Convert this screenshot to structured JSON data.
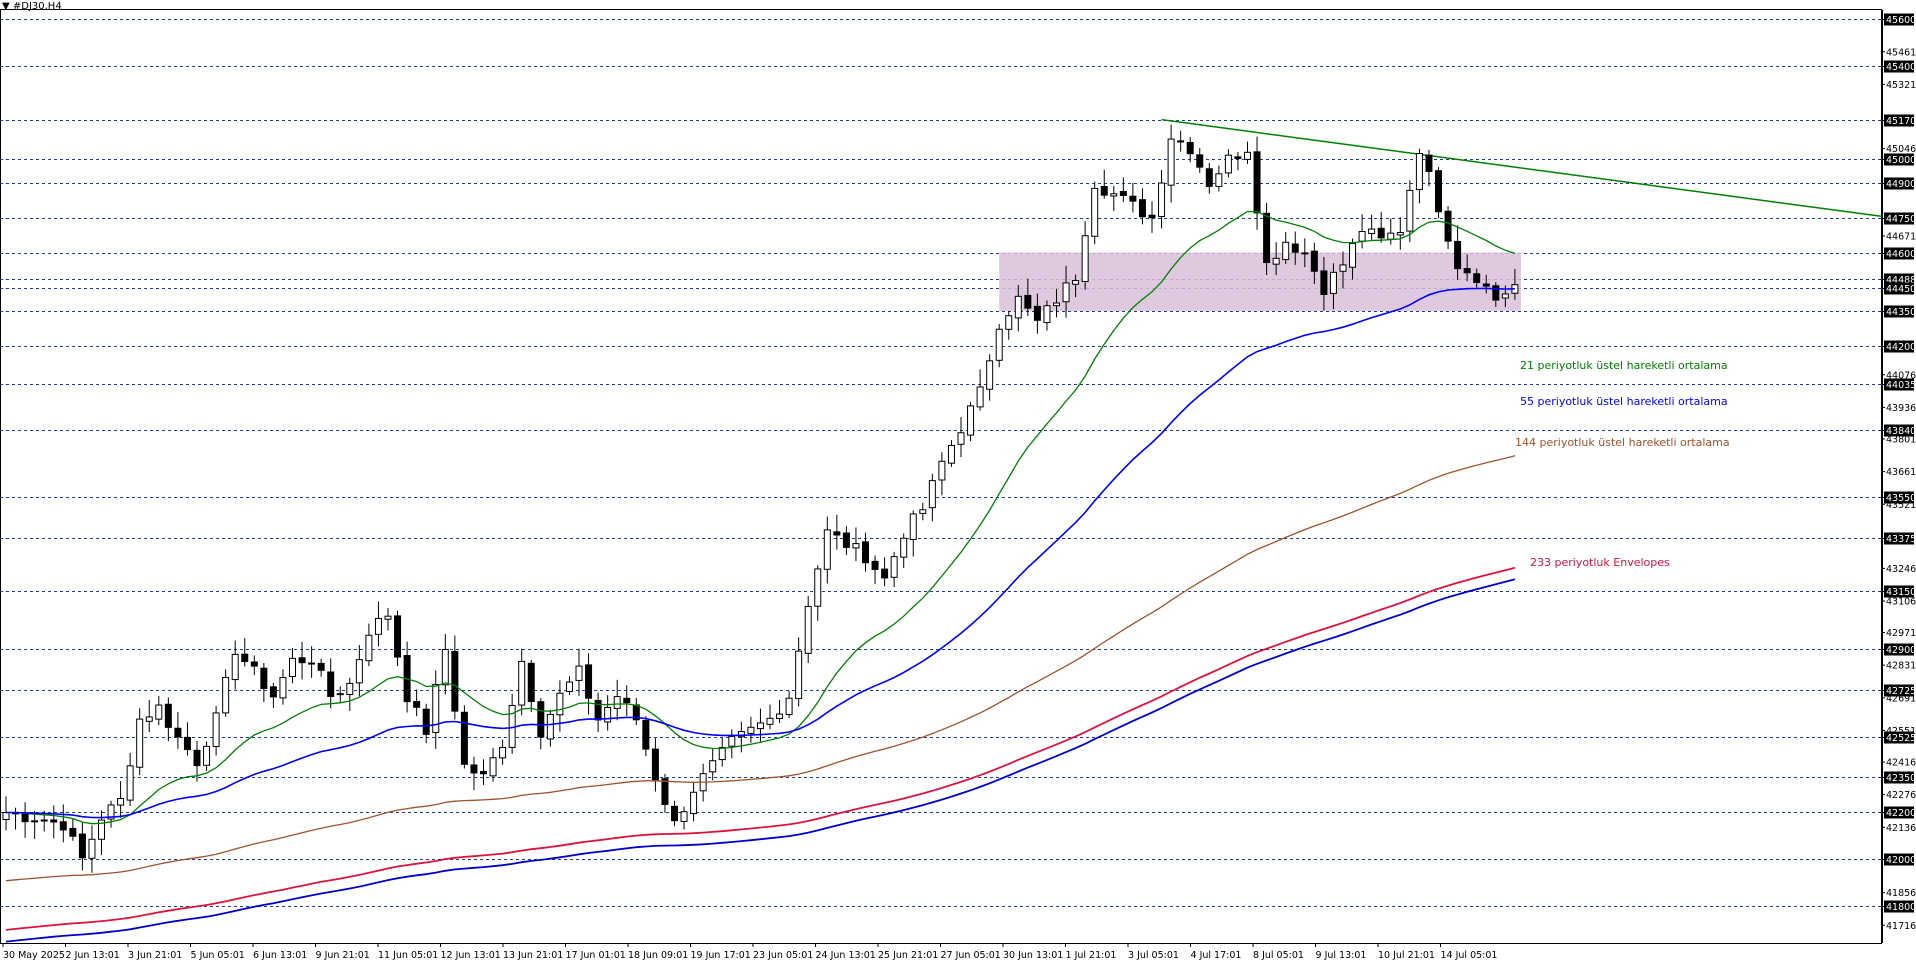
{
  "chart_title": "▼ #DJ30,H4",
  "chart_data": {
    "type": "candlestick",
    "symbol": "#DJ30",
    "timeframe": "H4",
    "ylim": [
      41640,
      45640
    ],
    "grid": "dashed horizontal lines at key levels",
    "key_levels": [
      45600,
      45400,
      45170,
      45000,
      44900,
      44750,
      44600,
      44488,
      44450,
      44350,
      44200,
      44035,
      43840,
      43550,
      43375,
      43150,
      42900,
      42725,
      42525,
      42350,
      42200,
      42000,
      41800
    ],
    "minor_ticks": [
      45461,
      45321,
      45046,
      44671,
      44076,
      43936,
      43801,
      43661,
      43521,
      43246,
      43106,
      42971,
      42831,
      42691,
      42551,
      42416,
      42276,
      42136,
      41856,
      41716
    ],
    "x_labels": [
      "30 May 2025",
      "2 Jun 13:01",
      "3 Jun 21:01",
      "5 Jun 05:01",
      "6 Jun 13:01",
      "9 Jun 21:01",
      "11 Jun 05:01",
      "12 Jun 13:01",
      "13 Jun 21:01",
      "17 Jun 01:01",
      "18 Jun 09:01",
      "19 Jun 17:01",
      "23 Jun 05:01",
      "24 Jun 13:01",
      "25 Jun 21:01",
      "27 Jun 05:01",
      "30 Jun 13:01",
      "1 Jul 21:01",
      "3 Jul 05:01",
      "4 Jul 17:01",
      "8 Jul 05:01",
      "9 Jul 13:01",
      "10 Jul 21:01",
      "14 Jul 05:01"
    ],
    "zone": {
      "low": 44350,
      "high": 44600,
      "color": "#d8bfd8"
    },
    "trendline": {
      "from": 45170,
      "to": 44755,
      "color": "#008000"
    },
    "series": [
      {
        "name": "21 periyotluk üstel hareketli ortalama",
        "color": "#008000"
      },
      {
        "name": "55 periyotluk üstel hareketli ortalama",
        "color": "#0000ff"
      },
      {
        "name": "144 periyotluk üstel hareketli ortalama",
        "color": "#a0522d"
      },
      {
        "name": "233 periyotluk Envelopes",
        "color": "#dc143c"
      }
    ],
    "close_path": [
      [
        0,
        42200
      ],
      [
        6,
        42150
      ],
      [
        8,
        42000
      ],
      [
        10,
        42180
      ],
      [
        12,
        42250
      ],
      [
        14,
        42600
      ],
      [
        16,
        42650
      ],
      [
        18,
        42520
      ],
      [
        20,
        42420
      ],
      [
        22,
        42600
      ],
      [
        24,
        42900
      ],
      [
        26,
        42800
      ],
      [
        28,
        42700
      ],
      [
        30,
        42850
      ],
      [
        32,
        42860
      ],
      [
        34,
        42700
      ],
      [
        36,
        42750
      ],
      [
        38,
        42980
      ],
      [
        40,
        43050
      ],
      [
        42,
        42700
      ],
      [
        44,
        42550
      ],
      [
        46,
        42900
      ],
      [
        48,
        42400
      ],
      [
        50,
        42350
      ],
      [
        52,
        42500
      ],
      [
        54,
        42850
      ],
      [
        56,
        42550
      ],
      [
        58,
        42700
      ],
      [
        60,
        42800
      ],
      [
        62,
        42600
      ],
      [
        64,
        42700
      ],
      [
        66,
        42600
      ],
      [
        68,
        42350
      ],
      [
        70,
        42150
      ],
      [
        72,
        42300
      ],
      [
        74,
        42400
      ],
      [
        76,
        42500
      ],
      [
        78,
        42550
      ],
      [
        80,
        42600
      ],
      [
        82,
        42700
      ],
      [
        84,
        43100
      ],
      [
        86,
        43400
      ],
      [
        88,
        43350
      ],
      [
        90,
        43300
      ],
      [
        92,
        43200
      ],
      [
        94,
        43400
      ],
      [
        96,
        43500
      ],
      [
        98,
        43700
      ],
      [
        100,
        43850
      ],
      [
        102,
        44000
      ],
      [
        104,
        44300
      ],
      [
        106,
        44400
      ],
      [
        108,
        44300
      ],
      [
        110,
        44400
      ],
      [
        112,
        44500
      ],
      [
        114,
        44900
      ],
      [
        116,
        44850
      ],
      [
        118,
        44800
      ],
      [
        120,
        44750
      ],
      [
        122,
        45100
      ],
      [
        124,
        45050
      ],
      [
        126,
        44900
      ],
      [
        128,
        45000
      ],
      [
        130,
        45050
      ],
      [
        132,
        44550
      ],
      [
        134,
        44650
      ],
      [
        136,
        44600
      ],
      [
        138,
        44450
      ],
      [
        140,
        44550
      ],
      [
        142,
        44700
      ],
      [
        144,
        44650
      ],
      [
        146,
        44700
      ],
      [
        148,
        45050
      ],
      [
        150,
        44800
      ],
      [
        152,
        44550
      ],
      [
        154,
        44500
      ],
      [
        156,
        44400
      ],
      [
        158,
        44460
      ]
    ]
  },
  "annotations": {
    "ema21": "21 periyotluk üstel hareketli ortalama",
    "ema55": "55 periyotluk üstel hareketli ortalama",
    "ema144": "144 periyotluk üstel hareketli ortalama",
    "env233": "233 periyotluk Envelopes"
  },
  "colors": {
    "background": "#ffffff",
    "grid": "#1f3a8a",
    "candle": "#000000",
    "label_box": "#000000"
  }
}
